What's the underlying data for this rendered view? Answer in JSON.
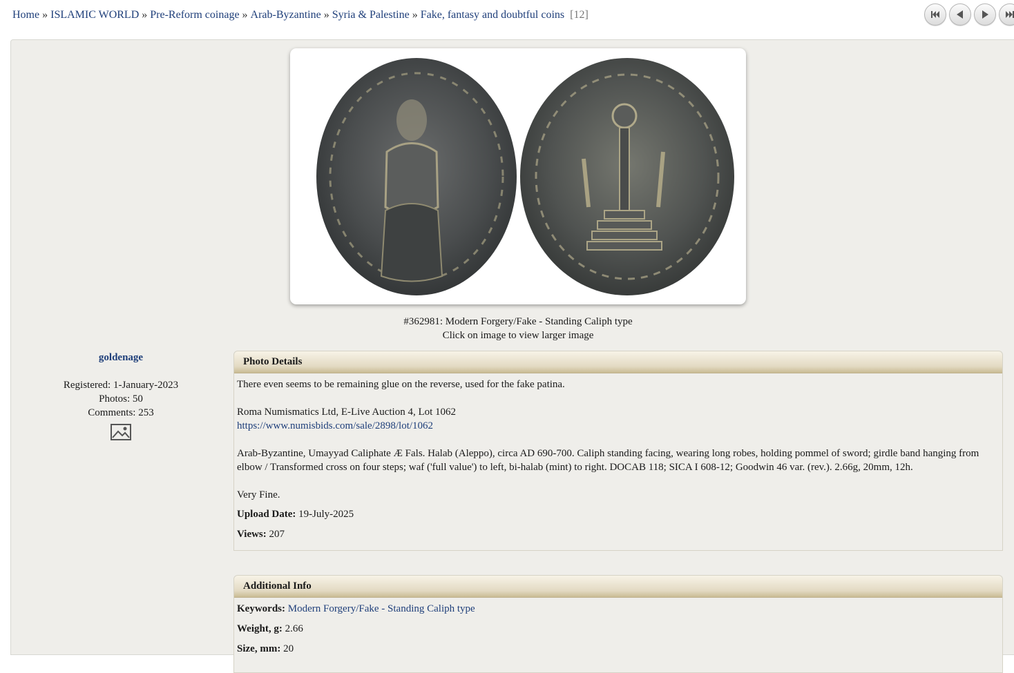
{
  "breadcrumb": {
    "items": [
      {
        "label": "Home"
      },
      {
        "label": "ISLAMIC WORLD"
      },
      {
        "label": "Pre-Reform coinage"
      },
      {
        "label": "Arab-Byzantine"
      },
      {
        "label": "Syria & Palestine"
      },
      {
        "label": "Fake, fantasy and doubtful coins"
      }
    ],
    "separator": "»",
    "count": "[12]"
  },
  "nav": {
    "first_icon": "first-page-icon",
    "prev_icon": "previous-icon",
    "next_icon": "next-icon",
    "last_icon": "last-page-icon"
  },
  "photo": {
    "caption": "#362981: Modern Forgery/Fake - Standing Caliph type",
    "hint": "Click on image to view larger image"
  },
  "user": {
    "name": "goldenage",
    "registered": "Registered: 1-January-2023",
    "photos": "Photos: 50",
    "comments": "Comments: 253",
    "gallery_icon": "image-placeholder-icon"
  },
  "photo_details": {
    "title": "Photo Details",
    "paragraph1": "There even seems to be remaining glue on the reverse, used for the fake patina.",
    "source_line": "Roma Numismatics Ltd, E-Live Auction 4, Lot 1062",
    "source_link": "https://www.numisbids.com/sale/2898/lot/1062",
    "description": "Arab-Byzantine, Umayyad Caliphate Æ Fals. Halab (Aleppo), circa AD 690-700. Caliph standing facing, wearing long robes, holding pommel of sword; girdle band hanging from elbow / Transformed cross on four steps; waf ('full value') to left, bi-halab (mint) to right. DOCAB 118; SICA I 608-12; Goodwin 46 var. (rev.). 2.66g, 20mm, 12h.",
    "grade": "Very Fine.",
    "upload_label": "Upload Date:",
    "upload_value": "19-July-2025",
    "views_label": "Views:",
    "views_value": "207"
  },
  "additional_info": {
    "title": "Additional Info",
    "keywords_label": "Keywords:",
    "keywords_value": "Modern Forgery/Fake - Standing Caliph type",
    "weight_label": "Weight, g:",
    "weight_value": "2.66",
    "next_label": "Size, mm:",
    "next_value": "20"
  },
  "colors": {
    "link": "#1f3f7a",
    "panel_bg": "#efeeea",
    "header_gradient_end": "#c9bb94"
  }
}
